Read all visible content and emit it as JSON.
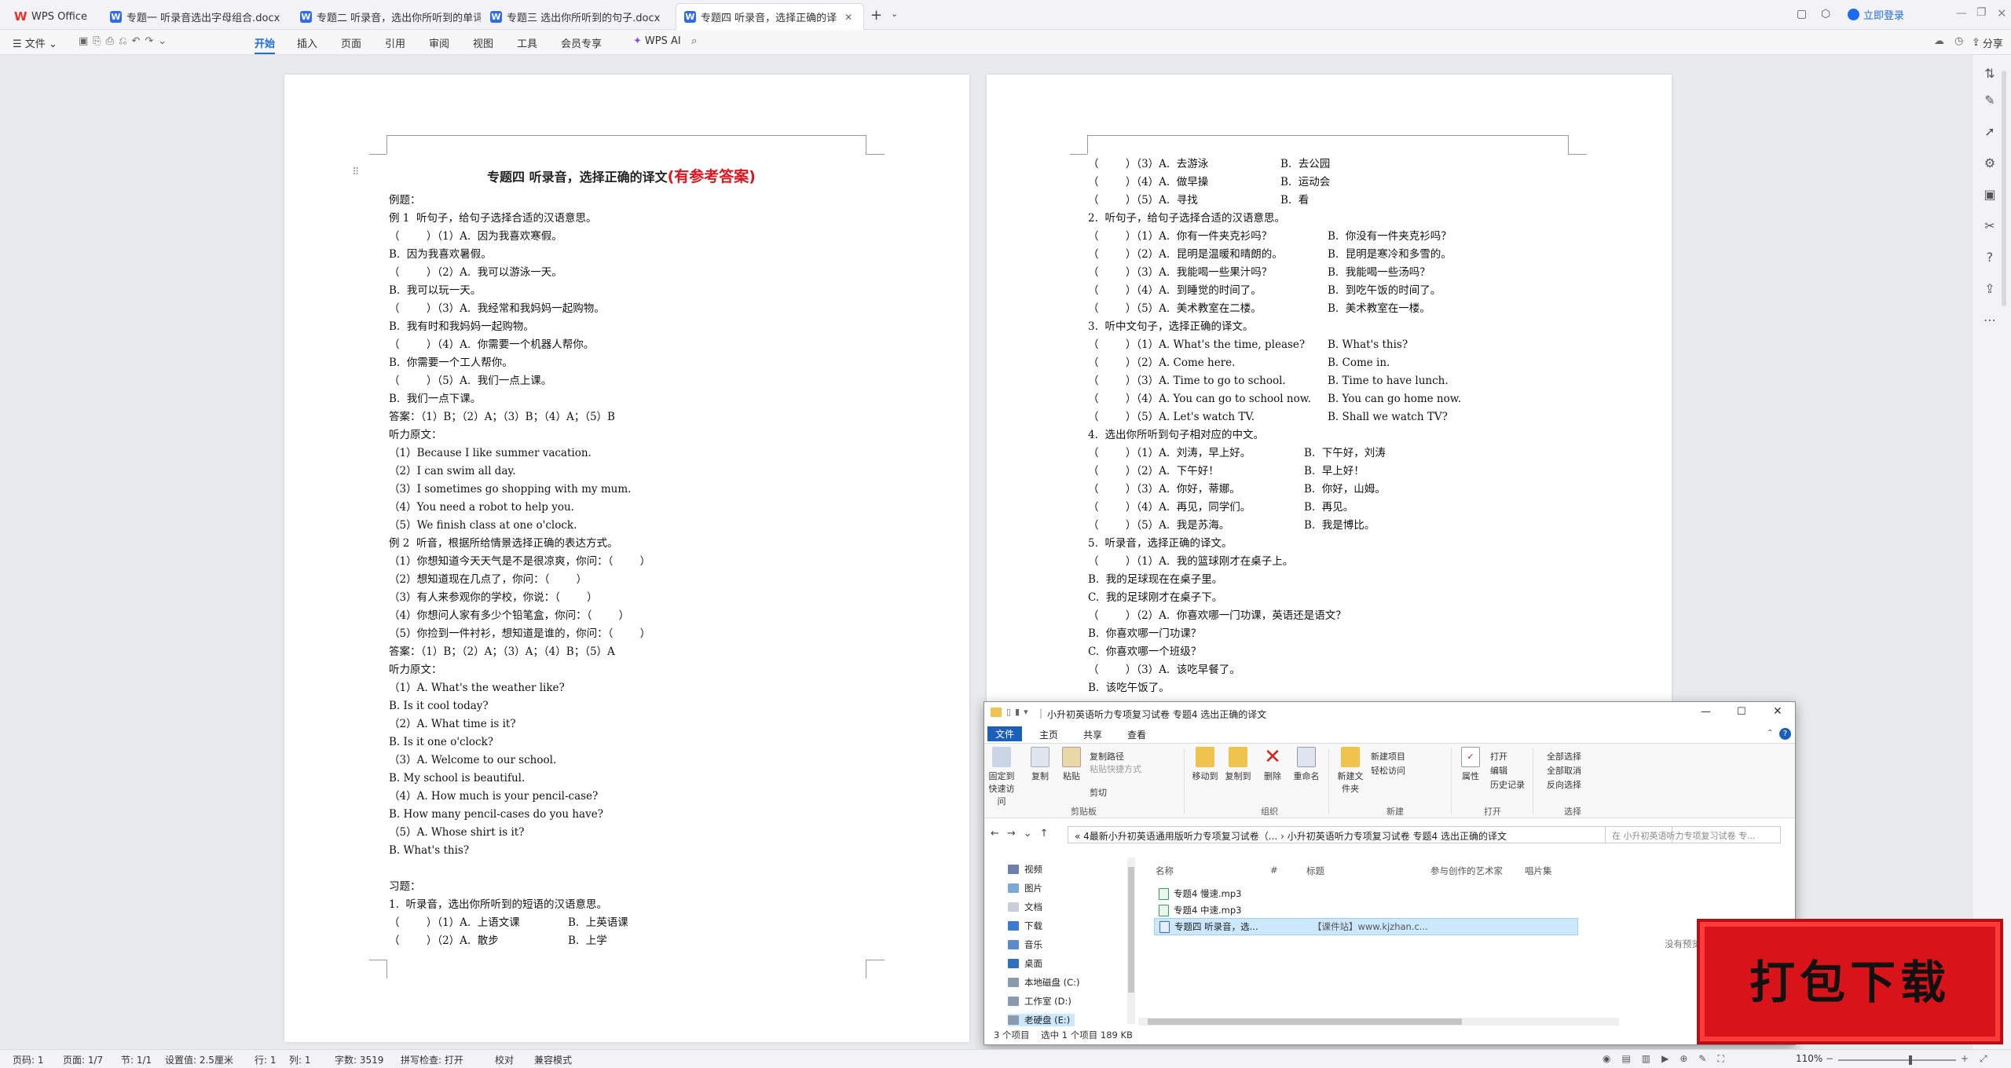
{
  "tabs": [
    {
      "label": "WPS Office"
    },
    {
      "label": "专题一 听录音选出字母组合.docx"
    },
    {
      "label": "专题二 听录音，选出你所听到的单词"
    },
    {
      "label": "专题三 选出你所听到的句子.docx"
    },
    {
      "label": "专题四 听录音，选择正确的译"
    }
  ],
  "window": {
    "login": "立即登录"
  },
  "toolbar": {
    "file": "文件",
    "tabs": [
      "开始",
      "插入",
      "页面",
      "引用",
      "审阅",
      "视图",
      "工具",
      "会员专享"
    ],
    "ai": "WPS AI",
    "share": "分享"
  },
  "doc_left": {
    "title": "专题四  听录音，选择正确的译文",
    "title_red": "(有参考答案)",
    "lines": [
      "例题：",
      "例 1  听句子，给句子选择合适的汉语意思。",
      "（        ）（1）A.  因为我喜欢寒假。",
      "B.  因为我喜欢暑假。",
      "（        ）（2）A.  我可以游泳一天。",
      "B.  我可以玩一天。",
      "（        ）（3）A.  我经常和我妈妈一起购物。",
      "B.  我有时和我妈妈一起购物。",
      "（        ）（4）A.  你需要一个机器人帮你。",
      "B.  你需要一个工人帮你。",
      "（        ）（5）A.  我们一点上课。",
      "B.  我们一点下课。",
      "答案：（1）B；（2）A；（3）B；（4）A；（5）B",
      "听力原文：",
      "（1）Because I like summer vacation.",
      "（2）I can swim all day.",
      "（3）I sometimes go shopping with my mum.",
      "（4）You need a robot to help you.",
      "（5）We finish class at one o'clock.",
      "例 2  听音，根据所给情景选择正确的表达方式。",
      "（1）你想知道今天天气是不是很凉爽，你问：（        ）",
      "（2）想知道现在几点了，你问：（        ）",
      "（3）有人来参观你的学校，你说：（        ）",
      "（4）你想问人家有多少个铅笔盒，你问：（        ）",
      "（5）你捡到一件衬衫，想知道是谁的，你问：（        ）",
      "答案：（1）B；（2）A；（3）A；（4）B；（5）A",
      "听力原文：",
      "（1）A. What's the weather like?",
      "B. Is it cool today?",
      "（2）A. What time is it?",
      "B. Is it one o'clock?",
      "（3）A. Welcome to our school.",
      "B. My school is beautiful.",
      "（4）A. How much is your pencil-case?",
      "B. How many pencil-cases do you have?",
      "（5）A. Whose shirt is it?",
      "B. What's this?",
      "",
      "习题：",
      "1.  听录音，选出你所听到的短语的汉语意思。"
    ],
    "rows": [
      {
        "a": "（        ）（1）A.  上语文课",
        "b": "B.  上英语课"
      },
      {
        "a": "（        ）（2）A.  散步",
        "b": "B.  上学"
      }
    ]
  },
  "doc_right": {
    "lines": [
      {
        "a": "（        ）（3）A.  去游泳",
        "b": "B.  去公园"
      },
      {
        "a": "（        ）（4）A.  做早操",
        "b": "B.  运动会"
      },
      {
        "a": "（        ）（5）A.  寻找",
        "b": "B.  看"
      },
      {
        "a": "2.  听句子，给句子选择合适的汉语意思。",
        "b": ""
      },
      {
        "a": "（        ）（1）A.  你有一件夹克衫吗？",
        "b": "B.  你没有一件夹克衫吗？"
      },
      {
        "a": "（        ）（2）A.  昆明是温暖和晴朗的。",
        "b": "B.  昆明是寒冷和多雪的。"
      },
      {
        "a": "（        ）（3）A.  我能喝一些果汁吗？",
        "b": "B.  我能喝一些汤吗？"
      },
      {
        "a": "（        ）（4）A.  到睡觉的时间了。",
        "b": "B.  到吃午饭的时间了。"
      },
      {
        "a": "（        ）（5）A.  美术教室在二楼。",
        "b": "B.  美术教室在一楼。"
      },
      {
        "a": "3.  听中文句子，选择正确的译文。",
        "b": ""
      },
      {
        "a": "（        ）（1）A. What's the time, please?",
        "b": "B. What's this?"
      },
      {
        "a": "（        ）（2）A. Come here.",
        "b": "B. Come in."
      },
      {
        "a": "（        ）（3）A. Time to go to school.",
        "b": "B. Time to have lunch."
      },
      {
        "a": "（        ）（4）A. You can go to school now.",
        "b": "B. You can go home now."
      },
      {
        "a": "（        ）（5）A. Let's watch TV.",
        "b": "B. Shall we watch TV?"
      },
      {
        "a": "4.  选出你所听到句子相对应的中文。",
        "b": ""
      },
      {
        "a": "（        ）（1）A.  刘涛，早上好。",
        "b": "B.  下午好，刘涛"
      },
      {
        "a": "（        ）（2）A.  下午好！",
        "b": "B.  早上好！"
      },
      {
        "a": "（        ）（3）A.  你好，蒂娜。",
        "b": "B.  你好，山姆。"
      },
      {
        "a": "（        ）（4）A.  再见，同学们。",
        "b": "B.  再见。"
      },
      {
        "a": "（        ）（5）A.  我是苏海。",
        "b": "B.  我是博比。"
      },
      {
        "a": "5.  听录音，选择正确的译文。",
        "b": ""
      },
      {
        "a": "（        ）（1）A.  我的篮球刚才在桌子上。",
        "b": ""
      },
      {
        "a": "B.  我的足球现在在桌子里。",
        "b": ""
      },
      {
        "a": "C.  我的足球刚才在桌子下。",
        "b": ""
      },
      {
        "a": "（        ）（2）A.  你喜欢哪一门功课，英语还是语文？",
        "b": ""
      },
      {
        "a": "B.  你喜欢哪一门功课？",
        "b": ""
      },
      {
        "a": "C.  你喜欢哪一个班级？",
        "b": ""
      },
      {
        "a": "（        ）（3）A.  该吃早餐了。",
        "b": ""
      },
      {
        "a": "B.  该吃午饭了。",
        "b": ""
      }
    ]
  },
  "explorer": {
    "title": "小升初英语听力专项复习试卷 专题4 选出正确的译文",
    "ribbon_tabs": [
      "文件",
      "主页",
      "共享",
      "查看"
    ],
    "buttons": {
      "pin": "固定到快速访问",
      "copy": "复制",
      "paste": "粘贴",
      "copy_path": "复制路径",
      "paste_shortcut": "粘贴快捷方式",
      "cut": "剪切",
      "move_to": "移动到",
      "copy_to": "复制到",
      "delete": "删除",
      "rename": "重命名",
      "new_folder": "新建文件夹",
      "new_item": "新建项目",
      "easy_access": "轻松访问",
      "properties": "属性",
      "open": "打开",
      "edit": "编辑",
      "history": "历史记录",
      "select_all": "全部选择",
      "select_none": "全部取消",
      "invert": "反向选择"
    },
    "groups": [
      "剪贴板",
      "组织",
      "新建",
      "打开",
      "选择"
    ],
    "address_parts": [
      "«",
      "4最新小升初英语通用版听力专项复习试卷（...",
      "›",
      "小升初英语听力专项复习试卷 专题4 选出正确的译文"
    ],
    "search_placeholder": "在 小升初英语听力专项复习试卷 专...",
    "nav": [
      "视频",
      "图片",
      "文档",
      "下载",
      "音乐",
      "桌面",
      "本地磁盘 (C:)",
      "工作室 (D:)",
      "老硬盘 (E:)"
    ],
    "columns": [
      "名称",
      "#",
      "标题",
      "参与创作的艺术家",
      "唱片集"
    ],
    "files": [
      {
        "name": "专题4 慢速.mp3",
        "title": ""
      },
      {
        "name": "专题4 中速.mp3",
        "title": ""
      },
      {
        "name": "专题四 听录音，选...",
        "title": "【课件站】www.kjzhan.c..."
      }
    ],
    "preview": "没有预览。",
    "status": [
      "3 个项目",
      "选中 1 个项目  189 KB"
    ]
  },
  "statusbar": {
    "items": [
      "页码: 1",
      "页面: 1/7",
      "节: 1/1",
      "设置值: 2.5厘米",
      "行: 1",
      "列: 1",
      "字数: 3519",
      "拼写检查: 打开",
      "校对",
      "兼容模式"
    ],
    "zoom": "110%"
  },
  "promo": {
    "text": "打包下载"
  }
}
